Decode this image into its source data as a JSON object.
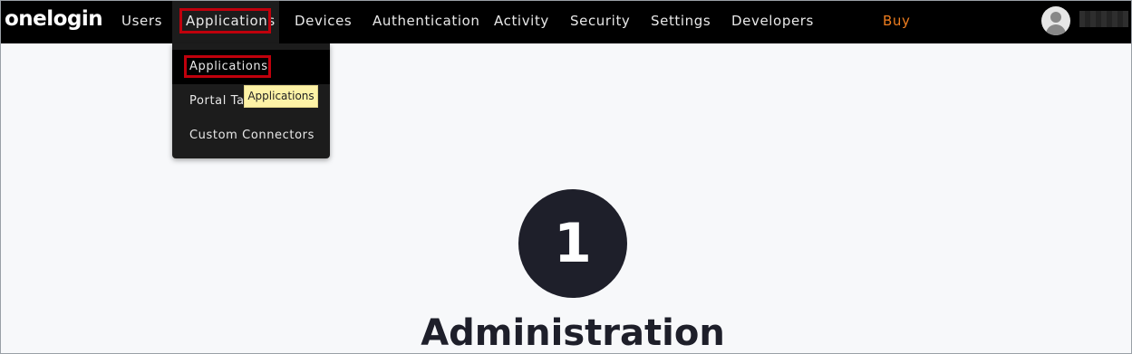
{
  "brand": {
    "logo": "onelogin"
  },
  "nav": {
    "items": [
      {
        "label": "Users"
      },
      {
        "label": "Applications"
      },
      {
        "label": "Devices"
      },
      {
        "label": "Authentication"
      },
      {
        "label": "Activity"
      },
      {
        "label": "Security"
      },
      {
        "label": "Settings"
      },
      {
        "label": "Developers"
      }
    ],
    "buy": "Buy",
    "active_item": "Applications"
  },
  "dropdown": {
    "items": [
      {
        "label": "Applications"
      },
      {
        "label": "Portal Tabs"
      },
      {
        "label": "Custom Connectors"
      }
    ]
  },
  "tooltip": {
    "text": "Applications"
  },
  "main": {
    "step_number": "1",
    "heading": "Administration"
  },
  "colors": {
    "topbar_bg": "#000000",
    "buy_accent": "#ee7d1f",
    "highlight_box": "#c0000c",
    "tooltip_bg": "#fdf2a6",
    "step_circle_bg": "#1e1f2a",
    "page_bg": "#f7f8fa"
  },
  "icons": {
    "avatar": "user-avatar-icon"
  }
}
